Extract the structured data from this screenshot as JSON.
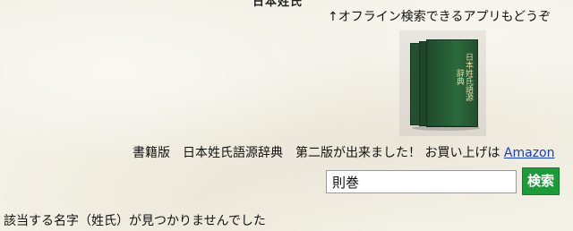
{
  "header": {
    "cut_text": "日本姓氏"
  },
  "promo": {
    "text": "↑オフライン検索できるアプリもどうぞ"
  },
  "book": {
    "cover_title": "日本姓氏語源辞典",
    "cover_color": "#2b6a3b",
    "title_color": "#e8d9a8"
  },
  "notice": {
    "text": "書籍版　日本姓氏語源辞典　第二版が出来ました！ お買い上げは",
    "link_label": "Amazon"
  },
  "search": {
    "value": "則巻",
    "button_label": "検索",
    "button_color": "#1e9a3a"
  },
  "result": {
    "message": "該当する名字（姓氏）が見つかりませんでした"
  }
}
